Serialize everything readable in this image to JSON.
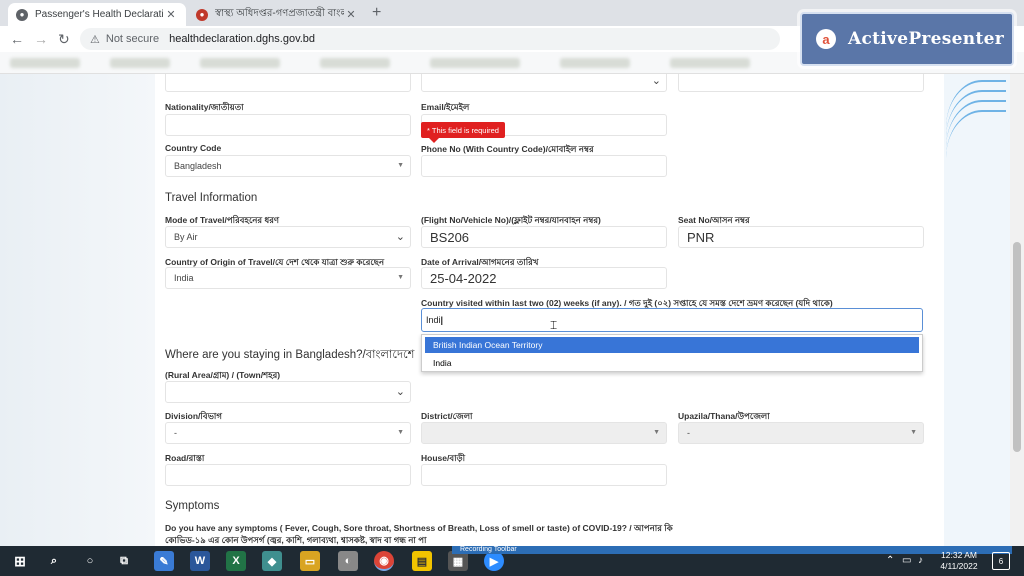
{
  "browser": {
    "tabs": [
      {
        "title": "Passenger's Health Declaration",
        "active": true
      },
      {
        "title": "স্বাস্থ্য অধিদপ্তর-গণপ্রজাতন্ত্রী বাংলা",
        "active": false
      }
    ],
    "new_tab": "+",
    "security_label": "Not secure",
    "url": "healthdeclaration.dghs.gov.bd"
  },
  "watermark": {
    "text": "ActivePresenter",
    "logo": "a"
  },
  "form": {
    "nationality_label": "Nationality/জাতীয়তা",
    "email_label": "Email/ইমেইল",
    "required_tooltip": "* This field is required",
    "country_code_label": "Country Code",
    "country_code_value": "Bangladesh",
    "phone_label": "Phone No (With Country Code)/মোবাইল নম্বর",
    "travel_section": "Travel Information",
    "mode_label": "Mode of Travel/পরিবহনের ধরণ",
    "mode_value": "By Air",
    "flight_label": "(Flight No/Vehicle No)/(ফ্লাইট নম্বর/যানবাহন নম্বর)",
    "flight_value": "BS206",
    "seat_label": "Seat No/আসন নম্বর",
    "seat_value": "PNR",
    "origin_label": "Country of Origin of Travel/যে দেশ থেকে যাত্রা শুরু করেছেন",
    "origin_value": "India",
    "arrival_label": "Date of Arrival/আগমনের তারিখ",
    "arrival_value": "25-04-2022",
    "visited_label": "Country visited within last two (02) weeks (if any). / গত দুই (০২) সপ্তাহে যে সমস্ত দেশে ভ্রমণ করেছেন (যদি থাকে)",
    "visited_value": "Indi",
    "visited_options": [
      "British Indian Ocean Territory",
      "India"
    ],
    "stay_section": "Where are you staying in Bangladesh?/বাংলাদেশে",
    "area_label": "(Rural Area/গ্রাম) / (Town/শহর)",
    "division_label": "Division/বিভাগ",
    "division_value": "-",
    "district_label": "District/জেলা",
    "upazila_label": "Upazila/Thana/উপজেলা",
    "upazila_value": "-",
    "road_label": "Road/রাস্তা",
    "house_label": "House/বাড়ী",
    "symptoms_section": "Symptoms",
    "symptoms_question": "Do you have any symptoms ( Fever, Cough, Sore throat, Shortness of Breath, Loss of smell or taste) of COVID-19? / আপনার কি",
    "symptoms_question_2": "কোভিড-১৯ এর কোন উপসর্গ (জ্বর, কাশি, গলাব্যথা, শ্বাসকষ্ট, স্বাদ বা গন্ধ না পা"
  },
  "taskbar": {
    "recording_label": "Recording Toolbar",
    "time": "12:32 AM",
    "date": "4/11/2022",
    "notification_count": "6",
    "icons": [
      "windows-start-icon",
      "search-icon",
      "cortana-icon",
      "task-view-icon",
      "paint-icon",
      "word-icon",
      "excel-icon",
      "app-icon",
      "files-icon",
      "app2-icon",
      "chrome-icon",
      "sticky-notes-icon",
      "calculator-icon",
      "zoom-icon"
    ]
  },
  "colors": {
    "accent": "#3875d7",
    "error": "#e02020",
    "taskbar": "#1f2a33"
  }
}
